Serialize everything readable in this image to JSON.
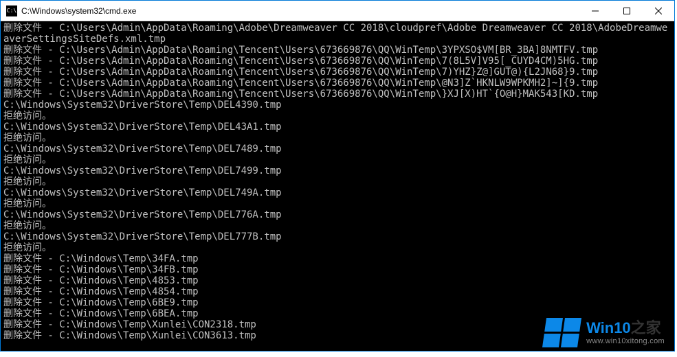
{
  "window": {
    "title": "C:\\Windows\\system32\\cmd.exe",
    "icon_label": "cmd-icon"
  },
  "terminal": {
    "lines": [
      "删除文件 - C:\\Users\\Admin\\AppData\\Roaming\\Adobe\\Dreamweaver CC 2018\\cloudpref\\Adobe Dreamweaver CC 2018\\AdobeDreamweaverSettingsSiteDefs.xml.tmp",
      "删除文件 - C:\\Users\\Admin\\AppData\\Roaming\\Tencent\\Users\\673669876\\QQ\\WinTemp\\3YPXSO$VM[BR_3BA]8NMTFV.tmp",
      "删除文件 - C:\\Users\\Admin\\AppData\\Roaming\\Tencent\\Users\\673669876\\QQ\\WinTemp\\7(8L5V]V95[_CUYD4CM)5HG.tmp",
      "删除文件 - C:\\Users\\Admin\\AppData\\Roaming\\Tencent\\Users\\673669876\\QQ\\WinTemp\\7)YHZ}Z@]GUT@){L2JN68}9.tmp",
      "删除文件 - C:\\Users\\Admin\\AppData\\Roaming\\Tencent\\Users\\673669876\\QQ\\WinTemp\\@N3]Z`HKNLW9WPKMH2]~]{9.tmp",
      "删除文件 - C:\\Users\\Admin\\AppData\\Roaming\\Tencent\\Users\\673669876\\QQ\\WinTemp\\}XJ[X)HT`{O@H}MAK543[KD.tmp",
      "C:\\Windows\\System32\\DriverStore\\Temp\\DEL4390.tmp",
      "拒绝访问。",
      "C:\\Windows\\System32\\DriverStore\\Temp\\DEL43A1.tmp",
      "拒绝访问。",
      "C:\\Windows\\System32\\DriverStore\\Temp\\DEL7489.tmp",
      "拒绝访问。",
      "C:\\Windows\\System32\\DriverStore\\Temp\\DEL7499.tmp",
      "拒绝访问。",
      "C:\\Windows\\System32\\DriverStore\\Temp\\DEL749A.tmp",
      "拒绝访问。",
      "C:\\Windows\\System32\\DriverStore\\Temp\\DEL776A.tmp",
      "拒绝访问。",
      "C:\\Windows\\System32\\DriverStore\\Temp\\DEL777B.tmp",
      "拒绝访问。",
      "删除文件 - C:\\Windows\\Temp\\34FA.tmp",
      "删除文件 - C:\\Windows\\Temp\\34FB.tmp",
      "删除文件 - C:\\Windows\\Temp\\4853.tmp",
      "删除文件 - C:\\Windows\\Temp\\4854.tmp",
      "删除文件 - C:\\Windows\\Temp\\6BE9.tmp",
      "删除文件 - C:\\Windows\\Temp\\6BEA.tmp",
      "删除文件 - C:\\Windows\\Temp\\Xunlei\\CON2318.tmp",
      "删除文件 - C:\\Windows\\Temp\\Xunlei\\CON3613.tmp"
    ]
  },
  "watermark": {
    "brand_prefix": "Win10",
    "brand_suffix": "之家",
    "url": "www.win10xitong.com"
  }
}
